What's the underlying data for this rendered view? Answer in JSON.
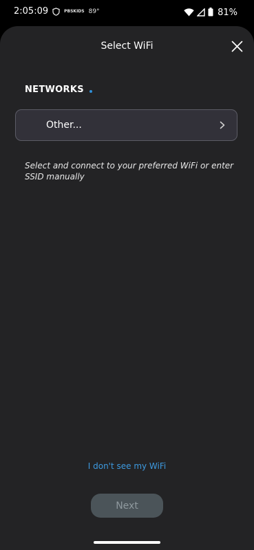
{
  "status_bar": {
    "time": "2:05:09",
    "mini_badge": "PBSKIDS",
    "temperature": "89°",
    "battery": "81%"
  },
  "sheet": {
    "title": "Select WiFi",
    "section_label": "NETWORKS",
    "network_row_label": "Other...",
    "help_text": "Select and connect to your preferred WiFi or enter SSID manually",
    "no_wifi_link": "I don't see my WiFi",
    "next_label": "Next"
  },
  "colors": {
    "sheet_bg": "#232325",
    "accent": "#3d9ae0",
    "row_bg": "#323139",
    "button_disabled_bg": "#4b5459"
  },
  "icons": {
    "status_left": [
      "shield-icon"
    ],
    "status_right": [
      "wifi-icon",
      "cell-signal-icon",
      "battery-icon"
    ],
    "close": "close-icon",
    "row": "chevron-right-icon"
  }
}
